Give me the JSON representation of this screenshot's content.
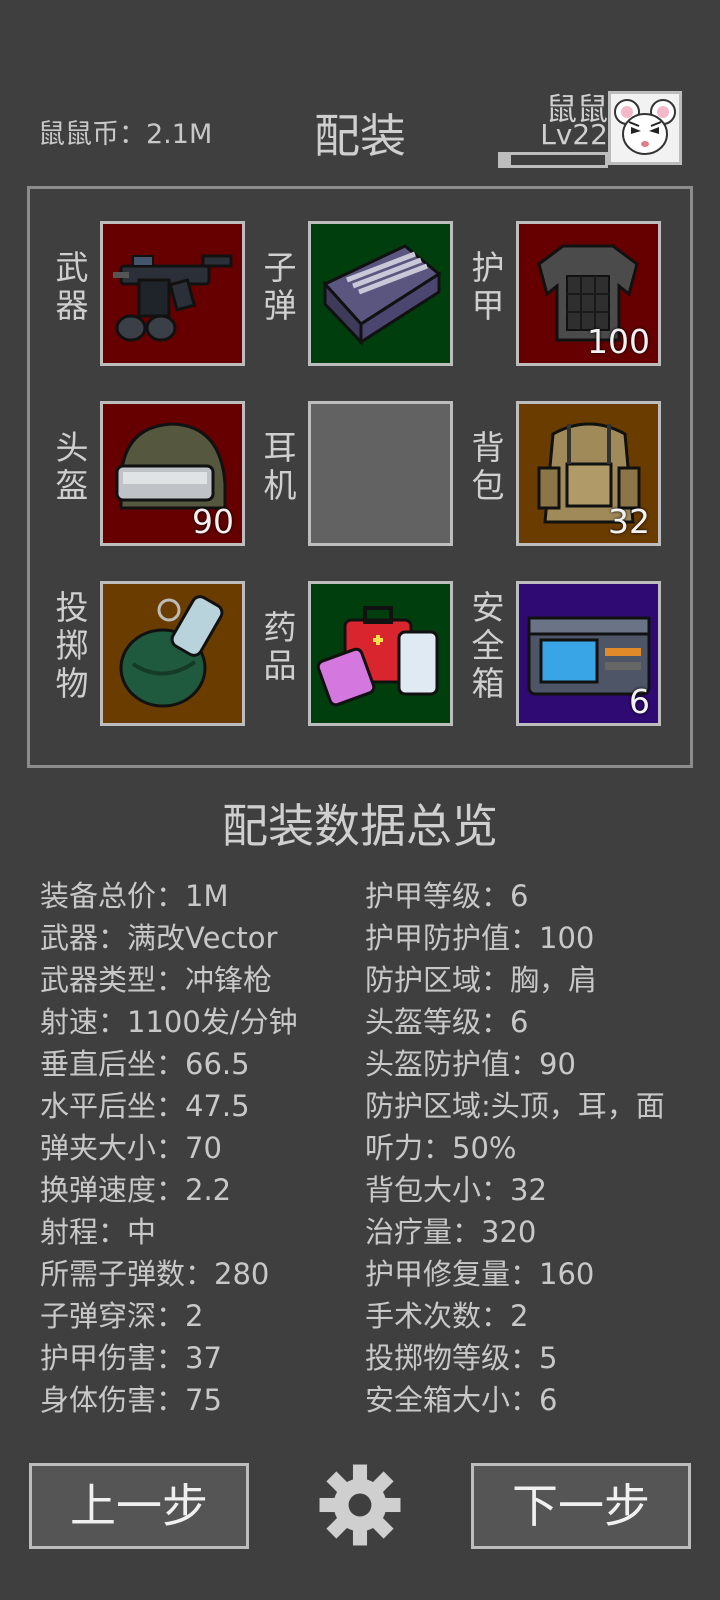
{
  "header": {
    "coins": "鼠鼠币：2.1M",
    "title": "配装",
    "player_name": "鼠鼠",
    "player_level": "Lv22",
    "xp_progress": 0.1
  },
  "slots": [
    {
      "label_l1": "武",
      "label_l2": "器",
      "label_l3": "",
      "icon": "smg-vector-icon",
      "count": ""
    },
    {
      "label_l1": "子",
      "label_l2": "弹",
      "label_l3": "",
      "icon": "ammo-box-icon",
      "count": ""
    },
    {
      "label_l1": "护",
      "label_l2": "甲",
      "label_l3": "",
      "icon": "body-armor-icon",
      "count": "100"
    },
    {
      "label_l1": "头",
      "label_l2": "盔",
      "label_l3": "",
      "icon": "helmet-icon",
      "count": "90"
    },
    {
      "label_l1": "耳",
      "label_l2": "机",
      "label_l3": "",
      "icon": "empty-slot",
      "count": ""
    },
    {
      "label_l1": "背",
      "label_l2": "包",
      "label_l3": "",
      "icon": "backpack-icon",
      "count": "32"
    },
    {
      "label_l1": "投",
      "label_l2": "掷",
      "label_l3": "物",
      "icon": "grenade-icon",
      "count": ""
    },
    {
      "label_l1": "药",
      "label_l2": "品",
      "label_l3": "",
      "icon": "medkit-icon",
      "count": ""
    },
    {
      "label_l1": "安",
      "label_l2": "全",
      "label_l3": "箱",
      "icon": "safe-box-icon",
      "count": "6"
    }
  ],
  "overview": {
    "title": "配装数据总览",
    "left": [
      "装备总价：1M",
      "武器：满改Vector",
      "武器类型：冲锋枪",
      "射速：1100发/分钟",
      "垂直后坐：66.5",
      "水平后坐：47.5",
      "弹夹大小：70",
      "换弹速度：2.2",
      "射程：中",
      "所需子弹数：280",
      "子弹穿深：2",
      "护甲伤害：37",
      "身体伤害：75"
    ],
    "right": [
      "护甲等级：6",
      "护甲防护值：100",
      "防护区域：胸，肩",
      "头盔等级：6",
      "头盔防护值：90",
      "防护区域:头顶，耳，面",
      "听力：50%",
      "背包大小：32",
      "治疗量：320",
      "护甲修复量：160",
      "手术次数：2",
      "投掷物等级：5",
      "安全箱大小：6"
    ]
  },
  "buttons": {
    "prev": "上一步",
    "next": "下一步",
    "settings_icon": "gear-icon"
  },
  "colors": {
    "background": "#3f3f3f",
    "slot_red": "#660000",
    "slot_green": "#003e0d",
    "slot_orange": "#6a3c00",
    "slot_purple": "#2e0a72",
    "slot_empty": "#626262"
  }
}
